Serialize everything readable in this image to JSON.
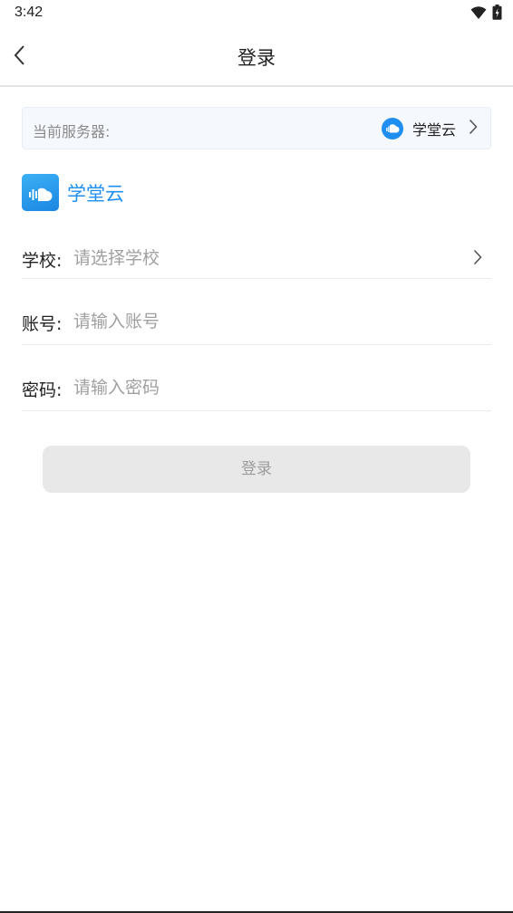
{
  "status_bar": {
    "time": "3:42",
    "icons": [
      "wifi-icon",
      "battery-icon"
    ]
  },
  "header": {
    "back_icon": "chevron-left-icon",
    "title": "登录"
  },
  "server": {
    "label": "当前服务器:",
    "name": "学堂云",
    "logo_icon": "cloud-logo-icon",
    "chevron_icon": "chevron-right-icon"
  },
  "brand": {
    "name": "学堂云",
    "logo_icon": "cloud-logo-icon"
  },
  "form": {
    "school": {
      "label": "学校:",
      "placeholder": "请选择学校",
      "value": ""
    },
    "account": {
      "label": "账号:",
      "placeholder": "请输入账号",
      "value": ""
    },
    "password": {
      "label": "密码:",
      "placeholder": "请输入密码",
      "value": ""
    }
  },
  "login_button": {
    "label": "登录",
    "enabled": false
  },
  "colors": {
    "brand_blue": "#1e8ff0",
    "server_bg": "#f5f9fd",
    "button_disabled_bg": "#e8e8e8",
    "button_disabled_text": "#9c9c9c"
  }
}
